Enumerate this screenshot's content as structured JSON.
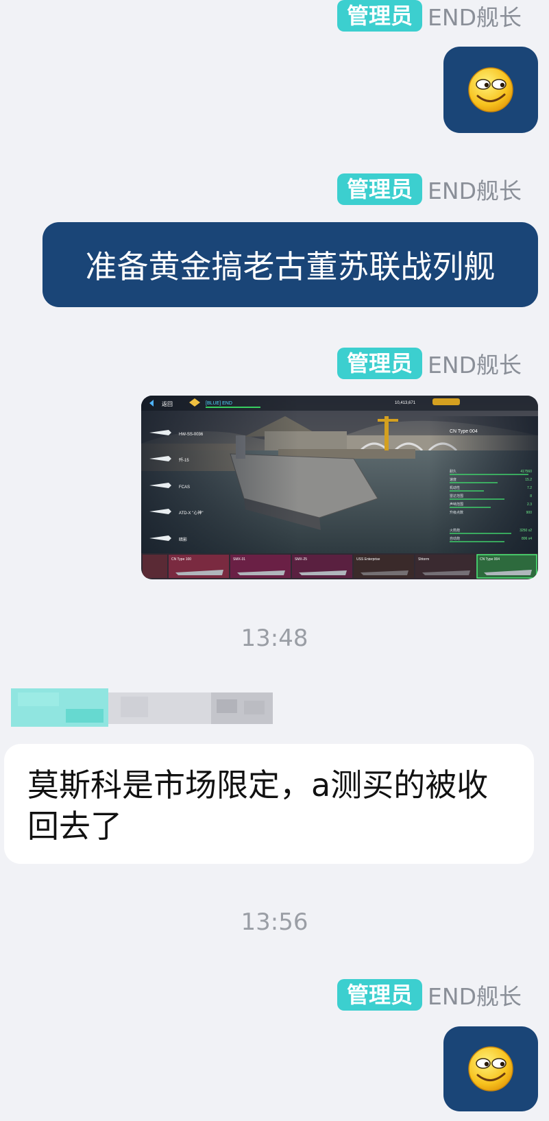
{
  "messages": [
    {
      "sender_badge": "管理员",
      "sender_name": "END舰长",
      "type": "emoji",
      "emoji": "smirk-face-emoji"
    },
    {
      "sender_badge": "管理员",
      "sender_name": "END舰长",
      "type": "text",
      "text": "准备黄金搞老古董苏联战列舰"
    },
    {
      "sender_badge": "管理员",
      "sender_name": "END舰长",
      "type": "image",
      "game_ui": {
        "back_label": "返回",
        "player_tag": "[BLUE] END",
        "score": "10,413,671",
        "ship_title": "CN Type 004",
        "stat_labels": [
          "耐久",
          "速度",
          "机动性",
          "雷达范围",
          "声呐范围",
          "升级点数"
        ],
        "stat_values": [
          "417560",
          "15.2",
          "7.2",
          "8",
          "2.3",
          "900"
        ],
        "fire_label": "火箭炮",
        "fire_value": "3250 x2",
        "aa_label": "自动炮",
        "aa_value": "806 x4",
        "aircraft": [
          "HW-SS-0036",
          "歼-15",
          "FCAS",
          "ATD-X \"心神\"",
          "暗影"
        ],
        "ships": [
          "CN Type 100",
          "SMX-31",
          "SMX-25",
          "USS Enterprise",
          "Shtorm",
          "CN Type 004"
        ]
      }
    }
  ],
  "divider_1": {
    "time": "13:48"
  },
  "incoming": {
    "sender_name": "",
    "text": "莫斯科是市场限定，a测买的被收回去了"
  },
  "divider_2": {
    "time": "13:56"
  },
  "last_message": {
    "sender_badge": "管理员",
    "sender_name": "END舰长",
    "type": "emoji",
    "emoji": "smirk-face-emoji"
  }
}
